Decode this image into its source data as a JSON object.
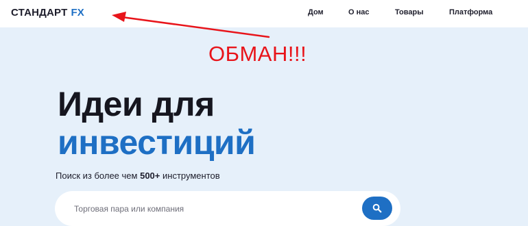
{
  "header": {
    "logo_main": "СТАНДАРТ",
    "logo_accent": "FX",
    "nav": {
      "home": "Дом",
      "about": "О нас",
      "goods": "Товары",
      "platform": "Платформа"
    }
  },
  "annotation": {
    "text": "ОБМАН!!!",
    "color": "#e8141a"
  },
  "hero": {
    "title_line1": "Идеи для",
    "title_line2": "инвестиций",
    "subtitle_prefix": "Поиск из более чем",
    "subtitle_bold": "500+",
    "subtitle_suffix": "инструментов"
  },
  "search": {
    "placeholder": "Торговая пара или компания",
    "value": "",
    "icon": "search-icon"
  },
  "colors": {
    "brand": "#1e6fc4",
    "background": "#e6f0fa",
    "text": "#16161f"
  }
}
